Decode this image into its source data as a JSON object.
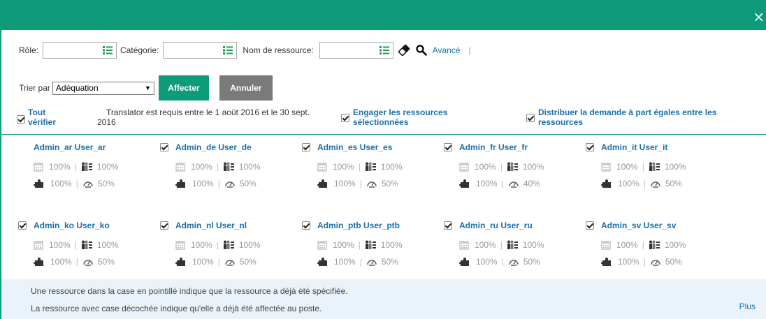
{
  "dialog": {
    "close_symbol": "×"
  },
  "filters": {
    "role_label": "Rôle:",
    "category_label": "Catégorie:",
    "resource_name_label": "Nom de ressource:",
    "advanced_label": "Avancé",
    "separator": "|"
  },
  "sort": {
    "label": "Trier par",
    "selected": "Adéquation",
    "assign_label": "Affecter",
    "cancel_label": "Annuler"
  },
  "options": {
    "check_all_line1": "Tout",
    "check_all_line2": "vérifier",
    "info_line1": "Translator est requis entre le 1 août 2016 et le 30 sept.",
    "info_line2": "2016",
    "engage_line1": "Engager les ressources",
    "engage_line2": "sélectionnées",
    "distribute_line1": "Distribuer la demande à part égales entre les",
    "distribute_line2": "ressources"
  },
  "resources": [
    {
      "name": "Admin_ar User_ar",
      "checked": false,
      "availability": "100%",
      "match": "100%",
      "skills": "100%",
      "load": "50%"
    },
    {
      "name": "Admin_de User_de",
      "checked": true,
      "availability": "100%",
      "match": "100%",
      "skills": "100%",
      "load": "50%"
    },
    {
      "name": "Admin_es User_es",
      "checked": true,
      "availability": "100%",
      "match": "100%",
      "skills": "100%",
      "load": "50%"
    },
    {
      "name": "Admin_fr User_fr",
      "checked": true,
      "availability": "100%",
      "match": "100%",
      "skills": "100%",
      "load": "40%"
    },
    {
      "name": "Admin_it User_it",
      "checked": true,
      "availability": "100%",
      "match": "100%",
      "skills": "100%",
      "load": "50%"
    },
    {
      "name": "Admin_ko User_ko",
      "checked": true,
      "availability": "100%",
      "match": "100%",
      "skills": "100%",
      "load": "50%"
    },
    {
      "name": "Admin_nl User_nl",
      "checked": true,
      "availability": "100%",
      "match": "100%",
      "skills": "100%",
      "load": "50%"
    },
    {
      "name": "Admin_ptb User_ptb",
      "checked": true,
      "availability": "100%",
      "match": "100%",
      "skills": "100%",
      "load": "50%"
    },
    {
      "name": "Admin_ru User_ru",
      "checked": true,
      "availability": "100%",
      "match": "100%",
      "skills": "100%",
      "load": "50%"
    },
    {
      "name": "Admin_sv User_sv",
      "checked": true,
      "availability": "100%",
      "match": "100%",
      "skills": "100%",
      "load": "50%"
    }
  ],
  "footer": {
    "line1": "Une ressource dans la case en pointillé indique que la ressource a déjà été spécifiée.",
    "line2": "La ressource avec case décochée indique qu'elle a déjà été affectée au poste.",
    "more_label": "Plus"
  },
  "colors": {
    "accent": "#0d9b7a",
    "link": "#1d6fa8",
    "muted": "#999999",
    "footer_bg": "#eaf3fa"
  }
}
